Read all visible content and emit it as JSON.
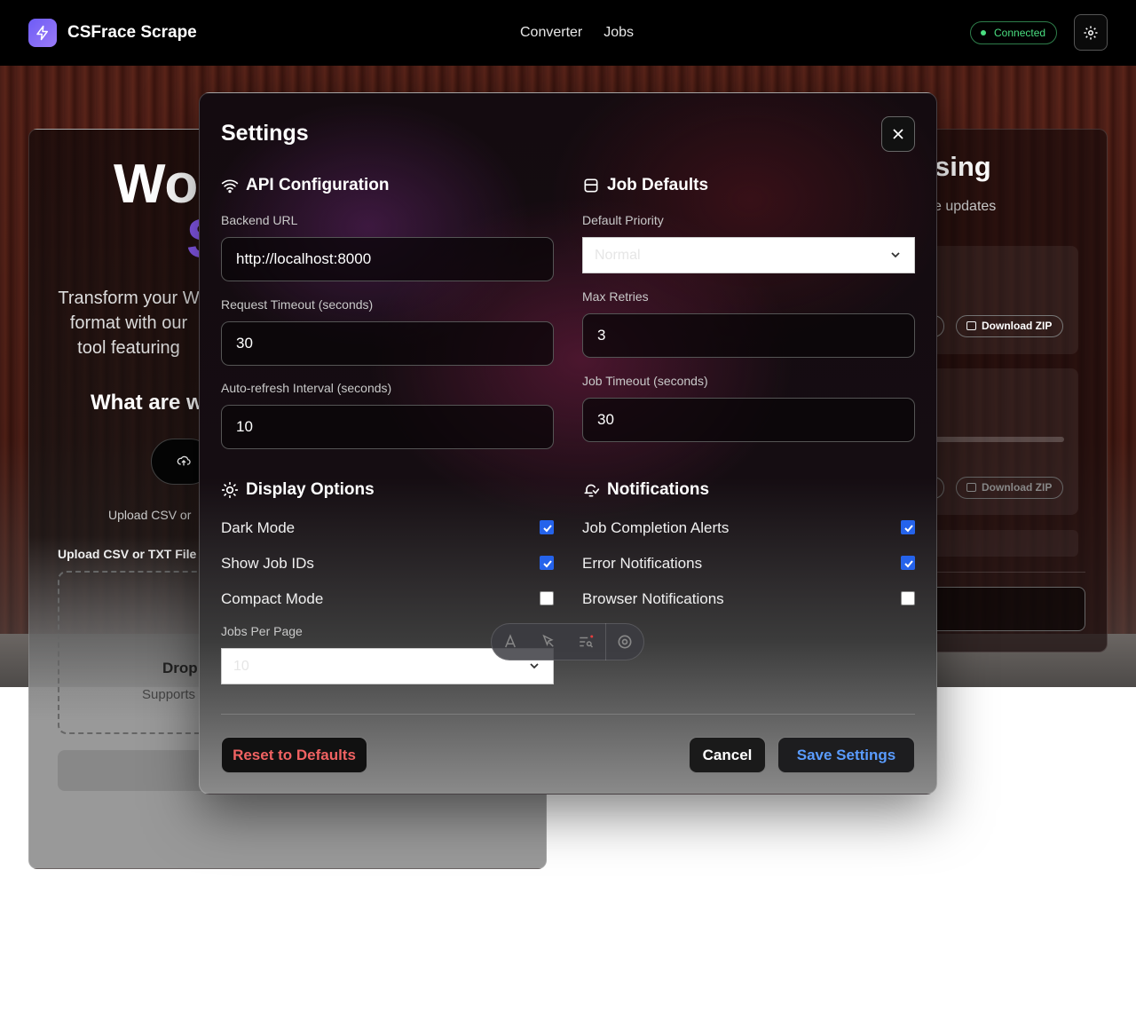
{
  "header": {
    "app_title": "CSFrace Scrape",
    "nav": [
      "Converter",
      "Jobs"
    ],
    "status": "Connected"
  },
  "background": {
    "hero_title": "Wo",
    "hero_accent": "S",
    "hero_desc": "Transform your W format with our tool featuring",
    "hero_question": "What are w",
    "upload_hint": "Upload CSV or",
    "upload_label": "Upload CSV or TXT File",
    "drop_text": "Drop",
    "drop_sub": "Supports",
    "right_title": "sing",
    "right_sub": "e updates",
    "download_label": "Download ZIP"
  },
  "modal": {
    "title": "Settings",
    "api": {
      "heading": "API Configuration",
      "backend_url_label": "Backend URL",
      "backend_url_value": "http://localhost:8000",
      "timeout_label": "Request Timeout (seconds)",
      "timeout_value": "30",
      "refresh_label": "Auto-refresh Interval (seconds)",
      "refresh_value": "10"
    },
    "job_defaults": {
      "heading": "Job Defaults",
      "priority_label": "Default Priority",
      "priority_value": "Normal",
      "retries_label": "Max Retries",
      "retries_value": "3",
      "job_timeout_label": "Job Timeout (seconds)",
      "job_timeout_value": "30"
    },
    "display": {
      "heading": "Display Options",
      "options": [
        {
          "label": "Dark Mode",
          "checked": true
        },
        {
          "label": "Show Job IDs",
          "checked": true
        },
        {
          "label": "Compact Mode",
          "checked": false
        }
      ],
      "per_page_label": "Jobs Per Page",
      "per_page_value": "10"
    },
    "notifications": {
      "heading": "Notifications",
      "options": [
        {
          "label": "Job Completion Alerts",
          "checked": true
        },
        {
          "label": "Error Notifications",
          "checked": true
        },
        {
          "label": "Browser Notifications",
          "checked": false
        }
      ]
    },
    "buttons": {
      "reset": "Reset to Defaults",
      "cancel": "Cancel",
      "save": "Save Settings"
    }
  },
  "colors": {
    "accent": "#8b5cf6",
    "status_green": "#4ade80",
    "checkbox_blue": "#2563eb",
    "danger": "#f06262",
    "save_blue": "#5a9cff"
  },
  "icons": [
    "bolt-icon",
    "gear-icon",
    "close-icon",
    "wifi-icon",
    "database-icon",
    "sun-icon",
    "bell-icon",
    "chevron-down-icon",
    "check-icon"
  ]
}
